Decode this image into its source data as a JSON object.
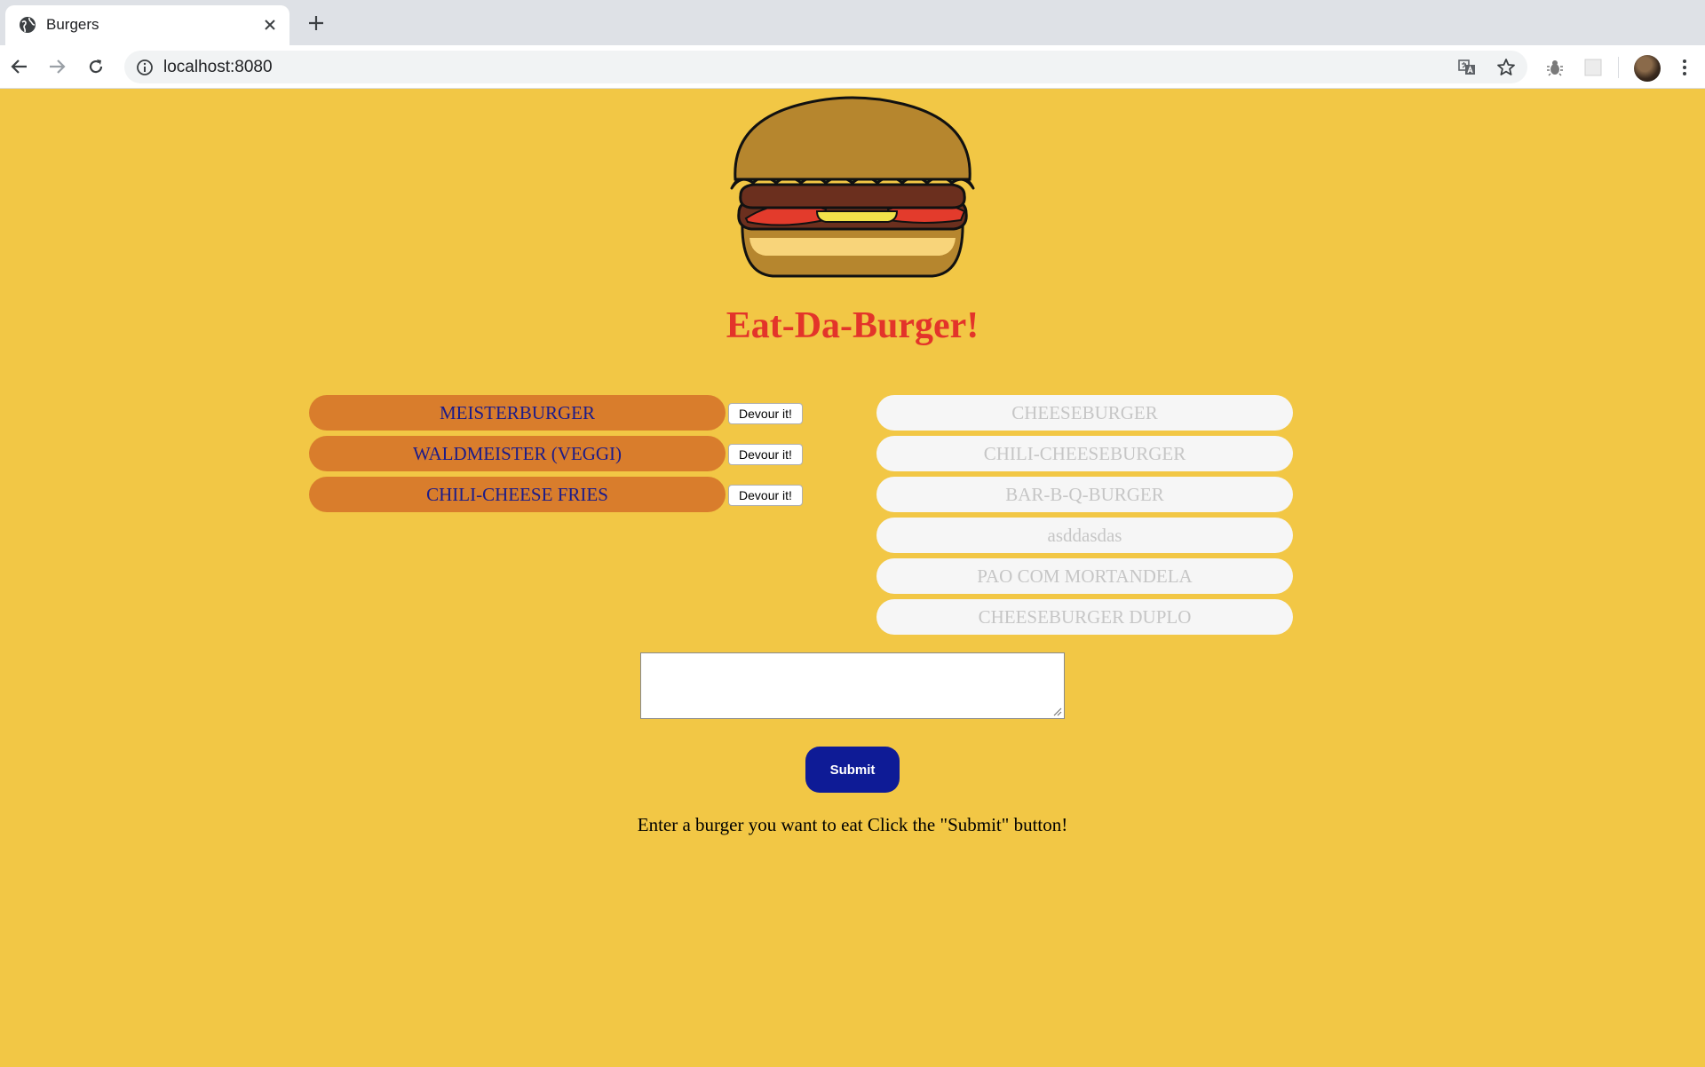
{
  "browser": {
    "tab_title": "Burgers",
    "url": "localhost:8080"
  },
  "page": {
    "headline": "Eat-Da-Burger!",
    "devour_label": "Devour it!",
    "available_burgers": [
      "MEISTERBURGER",
      "WALDMEISTER (VEGGI)",
      "CHILI-CHEESE FRIES"
    ],
    "devoured_burgers": [
      "CHEESEBURGER",
      "CHILI-CHEESEBURGER",
      "BAR-B-Q-BURGER",
      "asddasdas",
      "PAO COM MORTANDELA",
      "CHEESEBURGER DUPLO"
    ],
    "input_value": "",
    "submit_label": "Submit",
    "instructions": "Enter a burger you want to eat Click the \"Submit\" button!"
  },
  "colors": {
    "background": "#f2c745",
    "headline": "#e3342a",
    "available_pill": "#d97d2c",
    "available_text": "#1b1b8a",
    "devoured_pill": "#f6f6f6",
    "devoured_text": "#c6c6c6",
    "submit": "#0e1b96"
  },
  "icons": {
    "tab_favicon": "globe-icon",
    "tab_close": "close-icon",
    "new_tab": "plus-icon",
    "back": "back-arrow-icon",
    "forward": "forward-arrow-icon",
    "reload": "reload-icon",
    "site_info": "info-icon",
    "translate": "translate-icon",
    "bookmark": "star-icon",
    "extension_1": "bug-extension-icon",
    "extension_2": "extension-icon",
    "profile": "avatar",
    "menu": "kebab-menu-icon",
    "logo": "burger-logo"
  }
}
